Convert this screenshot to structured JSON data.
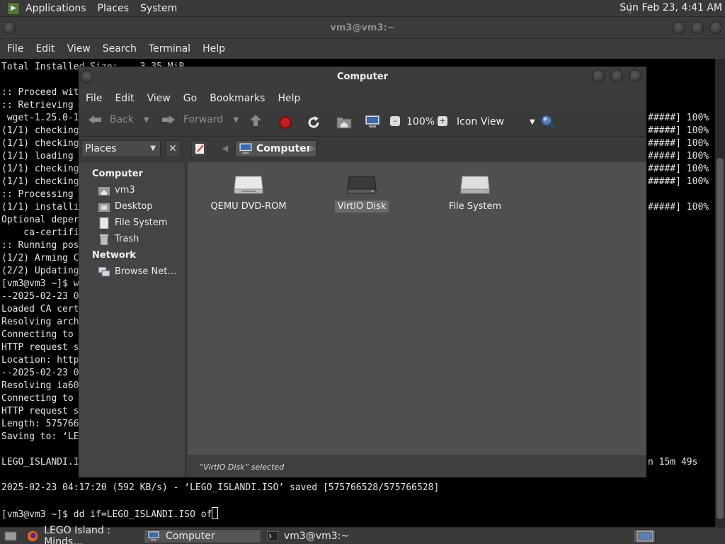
{
  "top_panel": {
    "menus": [
      "Applications",
      "Places",
      "System"
    ],
    "clock": "Sun Feb 23,  4:41 AM"
  },
  "terminal": {
    "title": "vm3@vm3:~",
    "menu": [
      "File",
      "Edit",
      "View",
      "Search",
      "Terminal",
      "Help"
    ],
    "lines_left": [
      "Total Installed Size:    3.35 MiB",
      "",
      ":: Proceed wit",
      ":: Retrieving",
      " wget-1.25.0-1",
      "(1/1) checking",
      "(1/1) checking",
      "(1/1) loading",
      "(1/1) checking",
      "(1/1) checking",
      ":: Processing",
      "(1/1) installi",
      "Optional deper",
      "    ca-certifi",
      ":: Running pos",
      "(1/2) Arming C",
      "(2/2) Updating",
      "[vm3@vm3 ~]$ w",
      "--2025-02-23 0",
      "Loaded CA cert",
      "Resolving arch",
      "Connecting to",
      "HTTP request s",
      "Location: http",
      "--2025-02-23 0",
      "Resolving ia60",
      "Connecting to",
      "HTTP request s",
      "Length: 575766",
      "Saving to: ‘LE",
      "",
      "LEGO_ISLANDI.I"
    ],
    "lines_right": [
      {
        "row": 4,
        "text": "#####] 100%"
      },
      {
        "row": 5,
        "text": "#####] 100%"
      },
      {
        "row": 6,
        "text": "#####] 100%"
      },
      {
        "row": 7,
        "text": "#####] 100%"
      },
      {
        "row": 8,
        "text": "#####] 100%"
      },
      {
        "row": 9,
        "text": "#####] 100%"
      },
      {
        "row": 11,
        "text": "#####] 100%"
      },
      {
        "row": 31,
        "text": "n 15m 49s"
      }
    ],
    "saved_line": "2025-02-23 04:17:20 (592 KB/s) - ‘LEGO_ISLANDI.ISO’ saved [575766528/575766528]",
    "prompt_line": "[vm3@vm3 ~]$ dd if=LEGO_ISLANDI.ISO of"
  },
  "file_manager": {
    "title": "Computer",
    "menu": [
      "File",
      "Edit",
      "View",
      "Go",
      "Bookmarks",
      "Help"
    ],
    "toolbar": {
      "back": "Back",
      "forward": "Forward",
      "zoom": "100%",
      "view_mode": "Icon View"
    },
    "places_label": "Places",
    "breadcrumb": "Computer",
    "sidebar": {
      "computer_heading": "Computer",
      "computer_items": [
        "vm3",
        "Desktop",
        "File System",
        "Trash"
      ],
      "network_heading": "Network",
      "network_items": [
        "Browse Net…"
      ]
    },
    "items": [
      {
        "label": "QEMU DVD-ROM",
        "selected": false
      },
      {
        "label": "VirtIO Disk",
        "selected": true
      },
      {
        "label": "File System",
        "selected": false
      }
    ],
    "status": "“VirtIO Disk” selected"
  },
  "taskbar": {
    "tasks": [
      "LEGO Island : Minds…",
      "Computer",
      "vm3@vm3:~"
    ]
  }
}
